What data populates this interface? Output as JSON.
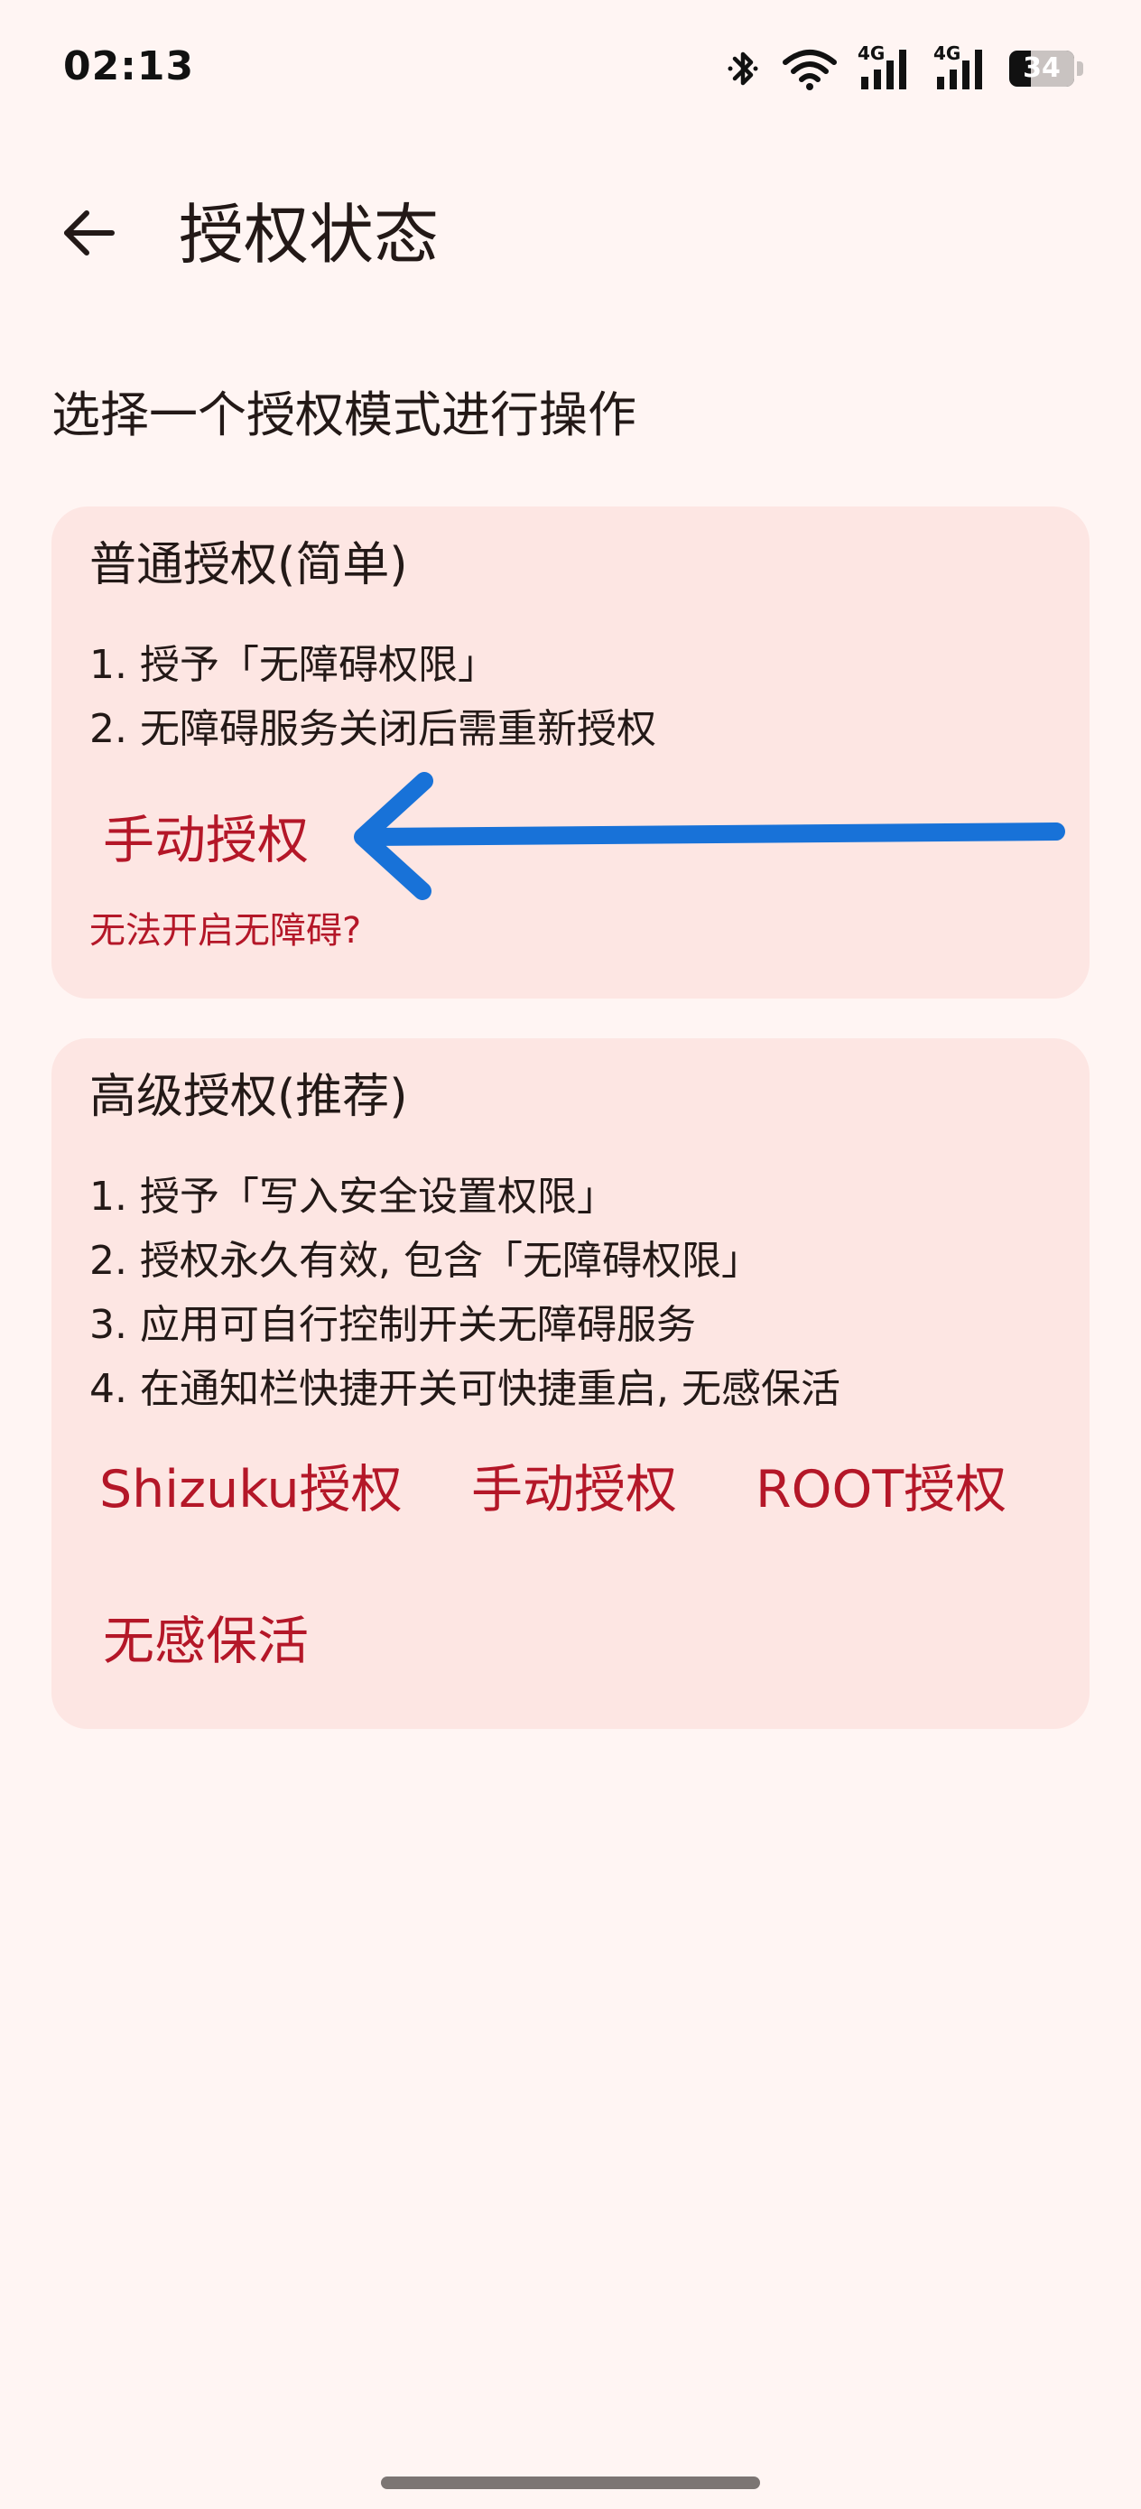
{
  "status_bar": {
    "time": "02:13",
    "network_type_1": "4G",
    "network_type_2": "4G",
    "battery_level": "34",
    "battery_fraction": 0.34
  },
  "app_bar": {
    "title": "授权状态",
    "back_icon": "arrow-back-icon"
  },
  "heading": "选择一个授权模式进行操作",
  "basic_card": {
    "title": "普通授权(简单)",
    "steps": [
      "1. 授予「无障碍权限」",
      "2. 无障碍服务关闭后需重新授权"
    ],
    "manual_button": "手动授权",
    "help_link": "无法开启无障碍?"
  },
  "advanced_card": {
    "title": "高级授权(推荐)",
    "steps": [
      "1. 授予「写入安全设置权限」",
      "2. 授权永久有效, 包含「无障碍权限」",
      "3. 应用可自行控制开关无障碍服务",
      "4. 在通知栏快捷开关可快捷重启, 无感保活"
    ],
    "buttons": {
      "shizuku": "Shizuku授权",
      "manual": "手动授权",
      "root": "ROOT授权",
      "keepalive": "无感保活"
    }
  },
  "colors": {
    "background": "#fff5f3",
    "card": "#fde6e3",
    "accent": "#b41728",
    "annotation_arrow": "#1872d8"
  }
}
